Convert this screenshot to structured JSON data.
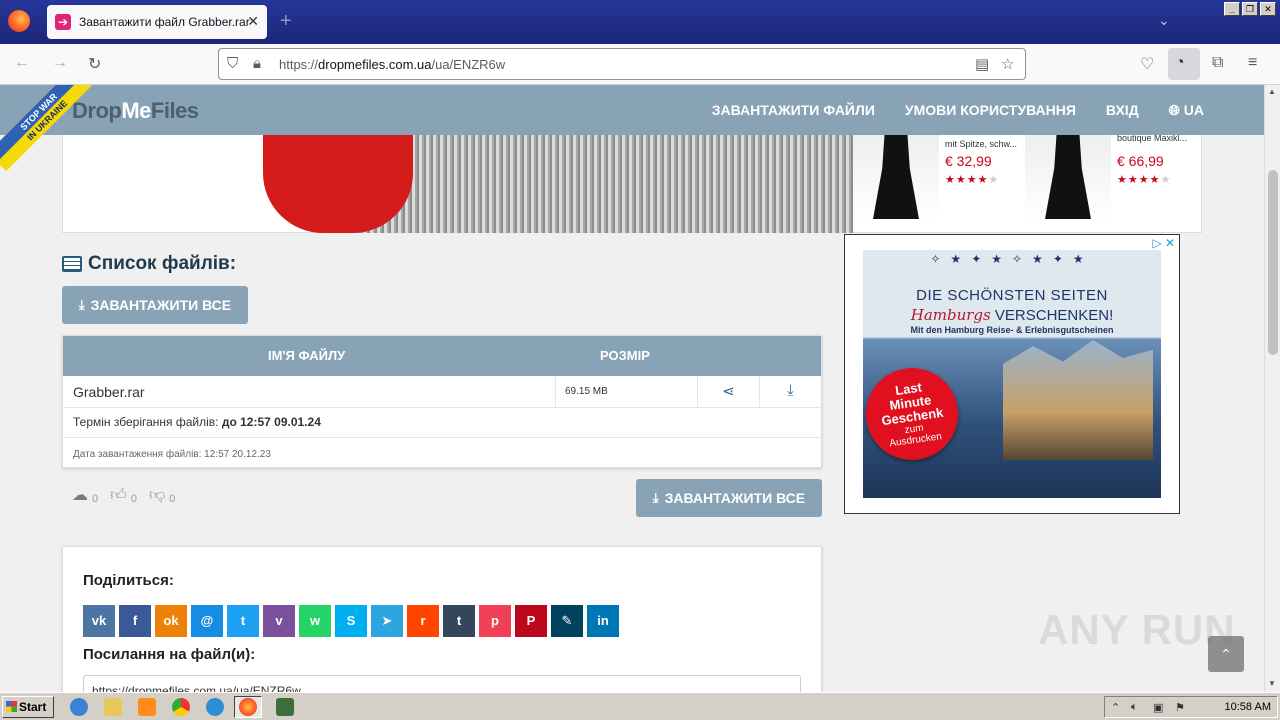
{
  "browser": {
    "tab_title": "Завантажити файл Grabber.rar",
    "tab_close": "✕",
    "new_tab": "+",
    "url_prefix": "https://",
    "url_host": "dropmefiles.com.ua",
    "url_path": "/ua/ENZR6w"
  },
  "site": {
    "logo_dark": "Drop",
    "logo_light": "Me",
    "logo_dark2": "Files",
    "stopwar_line1": "STOP WAR",
    "stopwar_line2": "IN UKRAINE",
    "menu": [
      "ЗАВАНТАЖИТИ ФАЙЛИ",
      "УМОВИ КОРИСТУВАННЯ",
      "ВХІД",
      "UA"
    ]
  },
  "top_ad": {
    "products": [
      {
        "name": "mit Spitze, schw...",
        "price": "€ 32,99",
        "rating": 4
      },
      {
        "name": "boutique Maxikl...",
        "price": "€ 66,99",
        "rating": 4
      }
    ]
  },
  "files": {
    "title": "Список файлів:",
    "download_all": "ЗАВАНТАЖИТИ ВСЕ",
    "col_name": "ІМ'Я ФАЙЛУ",
    "col_size": "РОЗМІР",
    "rows": [
      {
        "name": "Grabber.rar",
        "size": "69.15 MB"
      }
    ],
    "term_label": "Термін зберігання файлів:",
    "term_value": "до 12:57 09.01.24",
    "upload_date": "Дата завантаження файлів: 12:57 20.12.23",
    "stats": {
      "downloads": "0",
      "likes": "0",
      "dislikes": "0"
    }
  },
  "share": {
    "title": "Поділиться:",
    "link_title": "Посилання на файл(и):",
    "link_value": "https://dropmefiles.com.ua/ua/ENZR6w",
    "networks": [
      {
        "name": "vk",
        "glyph": "vk",
        "color": "#4c75a3"
      },
      {
        "name": "facebook",
        "glyph": "f",
        "color": "#3b5998"
      },
      {
        "name": "odnoklassniki",
        "glyph": "ok",
        "color": "#ee8208"
      },
      {
        "name": "moimir",
        "glyph": "@",
        "color": "#168de2"
      },
      {
        "name": "twitter",
        "glyph": "t",
        "color": "#1da1f2"
      },
      {
        "name": "viber",
        "glyph": "v",
        "color": "#7b519d"
      },
      {
        "name": "whatsapp",
        "glyph": "w",
        "color": "#25d366"
      },
      {
        "name": "skype",
        "glyph": "S",
        "color": "#00aff0"
      },
      {
        "name": "telegram",
        "glyph": "➤",
        "color": "#2ca5e0"
      },
      {
        "name": "reddit",
        "glyph": "r",
        "color": "#ff4500"
      },
      {
        "name": "tumblr",
        "glyph": "t",
        "color": "#35465c"
      },
      {
        "name": "pocket",
        "glyph": "p",
        "color": "#ef4056"
      },
      {
        "name": "pinterest",
        "glyph": "P",
        "color": "#bd081c"
      },
      {
        "name": "livejournal",
        "glyph": "✎",
        "color": "#00415d"
      },
      {
        "name": "linkedin",
        "glyph": "in",
        "color": "#0077b5"
      }
    ]
  },
  "side_ad": {
    "line1": "DIE SCHÖNSTEN SEITEN",
    "line2_italic": "Hamburgs",
    "line2_rest": " VERSCHENKEN!",
    "line3": "Mit den Hamburg Reise- & Erlebnisgutscheinen",
    "badge_1": "Last",
    "badge_2": "Minute",
    "badge_3": "Geschenk",
    "badge_4": "zum",
    "badge_5": "Ausdrucken"
  },
  "taskbar": {
    "start": "Start",
    "clock": "10:58 AM"
  },
  "watermark": "ANY RUN"
}
